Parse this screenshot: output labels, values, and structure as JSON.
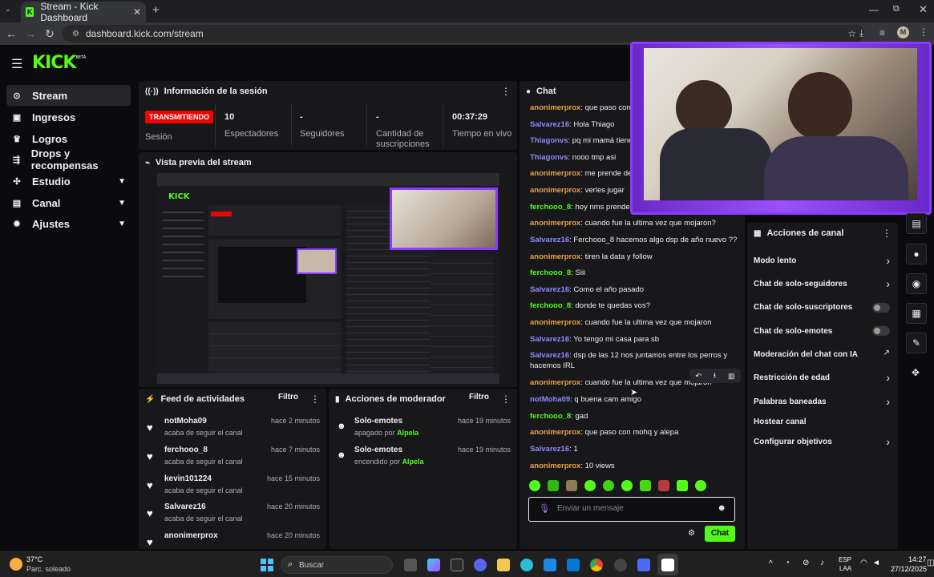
{
  "browser": {
    "tab_title": "Stream - Kick Dashboard",
    "url": "dashboard.kick.com/stream",
    "avatar_letter": "M"
  },
  "logo": "KICK",
  "logo_badge": "BETA",
  "sidebar": {
    "items": [
      {
        "label": "Stream",
        "icon": "link-icon",
        "active": true
      },
      {
        "label": "Ingresos",
        "icon": "wallet-icon"
      },
      {
        "label": "Logros",
        "icon": "trophy-icon"
      },
      {
        "label": "Drops y recompensas",
        "icon": "gift-icon"
      },
      {
        "label": "Estudio",
        "icon": "studio-icon",
        "expandable": true
      },
      {
        "label": "Canal",
        "icon": "channel-icon",
        "expandable": true
      },
      {
        "label": "Ajustes",
        "icon": "gear-icon",
        "expandable": true
      }
    ]
  },
  "session": {
    "title": "Información de la sesión",
    "live_badge": "TRANSMITIENDO",
    "session_label": "Sesión",
    "stats": [
      {
        "value": "10",
        "label": "Espectadores"
      },
      {
        "value": "-",
        "label": "Seguidores"
      },
      {
        "value": "-",
        "label": "Cantidad de suscripciones"
      },
      {
        "value": "00:37:29",
        "label": "Tiempo en vivo"
      }
    ]
  },
  "preview": {
    "title": "Vista previa del stream"
  },
  "feed": {
    "title": "Feed de actividades",
    "filter": "Filtro",
    "items": [
      {
        "name": "notMoha09",
        "action": "acaba de seguir el canal",
        "time": "hace 2 minutos"
      },
      {
        "name": "ferchooo_8",
        "action": "acaba de seguir el canal",
        "time": "hace 7 minutos"
      },
      {
        "name": "kevin101224",
        "action": "acaba de seguir el canal",
        "time": "hace 15 minutos"
      },
      {
        "name": "Salvarez16",
        "action": "acaba de seguir el canal",
        "time": "hace 20 minutos"
      },
      {
        "name": "anonimerprox",
        "action": "",
        "time": "hace 20 minutos"
      }
    ]
  },
  "mod_actions": {
    "title": "Acciones de moderador",
    "filter": "Filtro",
    "items": [
      {
        "name": "Solo-emotes",
        "status": "apagado por",
        "by": "Alpela",
        "time": "hace 19 minutos"
      },
      {
        "name": "Solo-emotes",
        "status": "encendido por",
        "by": "Alpela",
        "time": "hace 19 minutos"
      }
    ]
  },
  "chat": {
    "title": "Chat",
    "messages": [
      {
        "user": "anonimerprox",
        "color": "#e8a24a",
        "text": "que paso con el"
      },
      {
        "user": "Salvarez16",
        "color": "#8a8cff",
        "text": "Hola Thiago"
      },
      {
        "user": "Thiagonvs",
        "color": "#8a8cff",
        "text": "pq mi mamá tiene Ñ"
      },
      {
        "user": "Thiagonvs",
        "color": "#8a8cff",
        "text": "nooo tmp asi"
      },
      {
        "user": "anonimerprox",
        "color": "#e8a24a",
        "text": "me prende dema"
      },
      {
        "user": "anonimerprox",
        "color": "#e8a24a",
        "text": "verles jugar"
      },
      {
        "user": "ferchooo_8",
        "color": "#53fc18",
        "text": "hoy nms prenden?"
      },
      {
        "user": "anonimerprox",
        "color": "#e8a24a",
        "text": "cuando fue la ultima vez que mojaron?"
      },
      {
        "user": "Salvarez16",
        "color": "#8a8cff",
        "text": "Ferchooo_8 hacemos algo dsp de año nuevo ??"
      },
      {
        "user": "anonimerprox",
        "color": "#e8a24a",
        "text": "tiren la data y follow"
      },
      {
        "user": "ferchooo_8",
        "color": "#53fc18",
        "text": "Siii"
      },
      {
        "user": "Salvarez16",
        "color": "#8a8cff",
        "text": "Como el año pasado"
      },
      {
        "user": "ferchooo_8",
        "color": "#53fc18",
        "text": "donde te quedas vos?"
      },
      {
        "user": "anonimerprox",
        "color": "#e8a24a",
        "text": "cuando fue la ultima vez que mojaron"
      },
      {
        "user": "Salvarez16",
        "color": "#8a8cff",
        "text": "Yo tengo mi casa para sb"
      },
      {
        "user": "Salvarez16",
        "color": "#8a8cff",
        "text": "dsp de las 12 nos juntamos entre los perros y hacemos IRL"
      },
      {
        "user": "anonimerprox",
        "color": "#e8a24a",
        "text": "cuando fue la ultima vez que mojaron"
      },
      {
        "user": "notMoha09",
        "color": "#8a8cff",
        "text": "q buena cam amigo"
      },
      {
        "user": "ferchooo_8",
        "color": "#53fc18",
        "text": "gad"
      },
      {
        "user": "anonimerprox",
        "color": "#e8a24a",
        "text": "que paso con mohq y alepa"
      },
      {
        "user": "Salvarez16",
        "color": "#8a8cff",
        "text": "1"
      },
      {
        "user": "anonimerprox",
        "color": "#e8a24a",
        "text": "10 views"
      }
    ],
    "input_placeholder": "Enviar un mensaje",
    "send_label": "Chat"
  },
  "channel_actions": {
    "title": "Acciones de canal",
    "items": [
      {
        "label": "Modo lento",
        "control": "arrow"
      },
      {
        "label": "Chat de solo-seguidores",
        "control": "arrow"
      },
      {
        "label": "Chat de solo-suscriptores",
        "control": "toggle",
        "on": false
      },
      {
        "label": "Chat de solo-emotes",
        "control": "toggle",
        "on": false
      },
      {
        "label": "Moderación del chat con IA",
        "control": "external"
      },
      {
        "label": "Restricción de edad",
        "control": "arrow"
      },
      {
        "label": "Palabras baneadas",
        "control": "arrow"
      },
      {
        "label": "Hostear canal",
        "control": "none"
      },
      {
        "label": "Configurar objetivos",
        "control": "arrow"
      }
    ]
  },
  "taskbar": {
    "weather_temp": "37°C",
    "weather_desc": "Parc. soleado",
    "search_placeholder": "Buscar",
    "lang": "ESP",
    "lang_sub": "LAA",
    "time": "14:27",
    "date": "27/12/2025"
  },
  "colors": {
    "accent": "#53fc18",
    "live": "#eb0400",
    "overlay": "#8a3cff"
  }
}
